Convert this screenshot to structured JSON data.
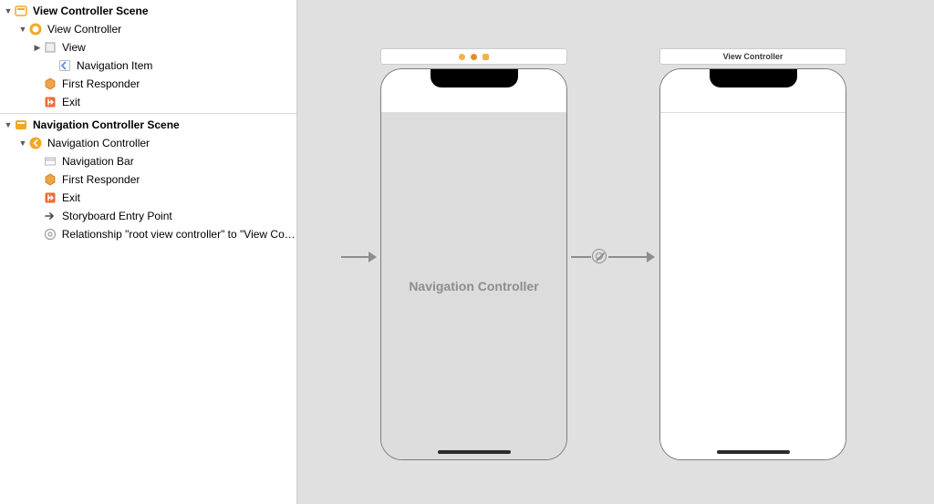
{
  "colors": {
    "scene_icon": "#f6a623",
    "vc_icon": "#f6a623",
    "view_icon_border": "#9e9e9e",
    "navitem_icon": "#5b8ff0",
    "first_responder_icon": "#e58a2b",
    "exit_icon": "#ec6b33",
    "entry_icon": "#4a4a4a",
    "segue_icon": "#9e9e9e",
    "title_dot1": "#f0b24a",
    "title_dot2": "#e58a2b",
    "title_sq": "#f0b24a"
  },
  "outline": {
    "scene1": {
      "title": "View Controller Scene",
      "items": {
        "vc": "View Controller",
        "view": "View",
        "navitem": "Navigation Item",
        "first_responder": "First Responder",
        "exit": "Exit"
      }
    },
    "scene2": {
      "title": "Navigation Controller Scene",
      "items": {
        "nc": "Navigation Controller",
        "navbar": "Navigation Bar",
        "first_responder": "First Responder",
        "exit": "Exit",
        "entry": "Storyboard Entry Point",
        "segue": "Relationship \"root view controller\" to \"View Cont..."
      }
    }
  },
  "canvas": {
    "nav_scene": {
      "content_label": "Navigation Controller"
    },
    "vc_scene": {
      "title": "View Controller"
    }
  }
}
